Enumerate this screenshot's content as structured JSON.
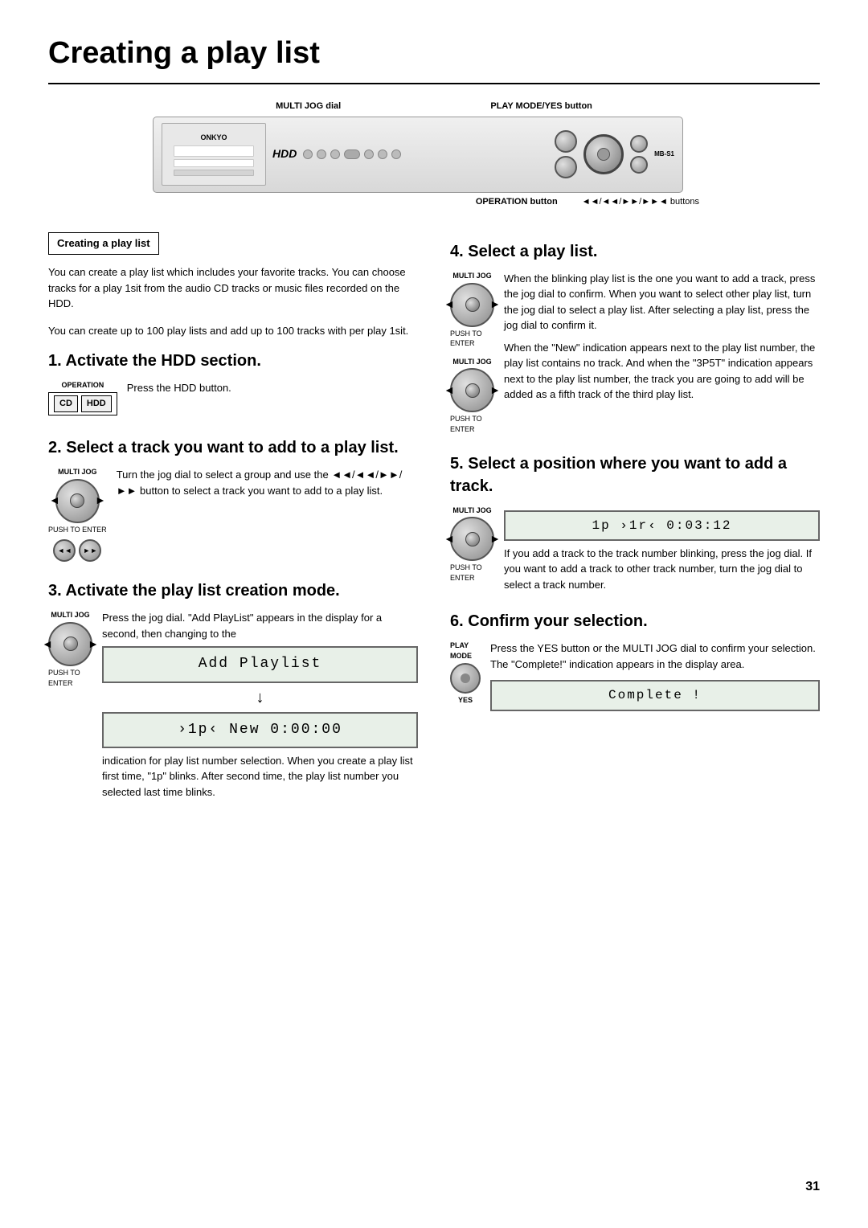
{
  "page": {
    "title": "Creating a play list",
    "page_number": "31"
  },
  "diagram": {
    "label_multi_jog": "MULTI JOG dial",
    "label_play_mode": "PLAY MODE/YES button",
    "label_operation": "OPERATION button",
    "label_buttons": "◄◄/◄◄/►►/►►◄ buttons"
  },
  "sidebar": {
    "box_title": "Creating a play list"
  },
  "intro": {
    "para1": "You can create a play list which includes your favorite tracks. You can choose tracks for a play 1sit from the audio CD tracks or music files recorded on the HDD.",
    "para2": "You can create up to 100 play lists and add up to 100 tracks with per play 1sit."
  },
  "steps": [
    {
      "number": "1",
      "title": "Activate the HDD section.",
      "operation_label": "OPERATION",
      "btn_cd": "CD",
      "btn_hdd": "HDD",
      "text": "Press the HDD button."
    },
    {
      "number": "2",
      "title": "Select a track you want to add to a play list.",
      "jog_label": "MULTI JOG",
      "push_label": "PUSH TO ENTER",
      "text": "Turn the jog dial to select a group and use the ◄◄/◄◄/►►/►► button to select a track you want to add to a play list."
    },
    {
      "number": "3",
      "title": "Activate the play list creation mode.",
      "jog_label": "MULTI JOG",
      "push_label": "PUSH TO ENTER",
      "text": "Press the jog dial. \"Add PlayList\" appears in the display for a second, then changing to the",
      "display1": "Add Playlist",
      "display2": "›1p‹ New 0:00:00",
      "text2": "indication for play list number selection. When you create a play list first time, \"1p\" blinks. After second time, the play list number you selected last time blinks."
    },
    {
      "number": "4",
      "title": "Select a play list.",
      "jog_label": "MULTI JOG",
      "push_label": "PUSH TO ENTER",
      "text1": "When the blinking play list is the one you want to add a track, press the jog dial to confirm. When you want to select other play list, turn the jog dial to select a play list. After selecting a play list, press the jog dial to confirm it.",
      "text2": "When the \"New\" indication appears next to the play list number, the play list contains no track. And when the \"3P5T\" indication appears next to the play list number, the track you are going to add will be added as a fifth track of the third play list."
    },
    {
      "number": "5",
      "title": "Select a position where you want to add a track.",
      "jog_label": "MULTI JOG",
      "push_label": "PUSH TO ENTER",
      "display": "1p  ›1r‹ 0:03:12",
      "text": "If you add a track to the track number blinking, press the jog dial. If you want to add a track to other track number, turn the jog dial to select a track number."
    },
    {
      "number": "6",
      "title": "Confirm your selection.",
      "play_mode_label": "PLAY MODE",
      "yes_label": "YES",
      "text": "Press the YES button or the MULTI JOG dial to confirm your selection. The \"Complete!\" indication appears in the display area.",
      "display": "Complete !"
    }
  ]
}
